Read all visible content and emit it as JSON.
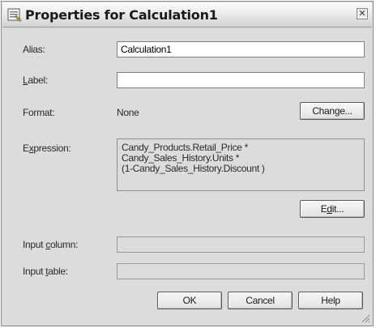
{
  "dialog": {
    "title": "Properties for Calculation1",
    "icon": "properties-icon",
    "close_icon": "close-icon"
  },
  "alias": {
    "label": "Alias:",
    "value": "Calculation1"
  },
  "label_field": {
    "label_prefix": "L",
    "label_rest": "abel:",
    "value": ""
  },
  "format": {
    "label": "Format:",
    "value": "None",
    "change_button": {
      "pre": "Chan",
      "ul": "g",
      "post": "e..."
    }
  },
  "expression": {
    "label_prefix": "E",
    "label_ul": "x",
    "label_rest": "pression:",
    "text": "Candy_Products.Retail_Price *\nCandy_Sales_History.Units *\n(1-Candy_Sales_History.Discount )",
    "edit_button": {
      "pre": "E",
      "ul": "d",
      "post": "it..."
    }
  },
  "input_column": {
    "label_pre": "Input ",
    "label_ul": "c",
    "label_post": "olumn:",
    "value": ""
  },
  "input_table": {
    "label_pre": "Input ",
    "label_ul": "t",
    "label_post": "able:",
    "value": ""
  },
  "buttons": {
    "ok": "OK",
    "cancel": "Cancel",
    "help": "Help"
  }
}
